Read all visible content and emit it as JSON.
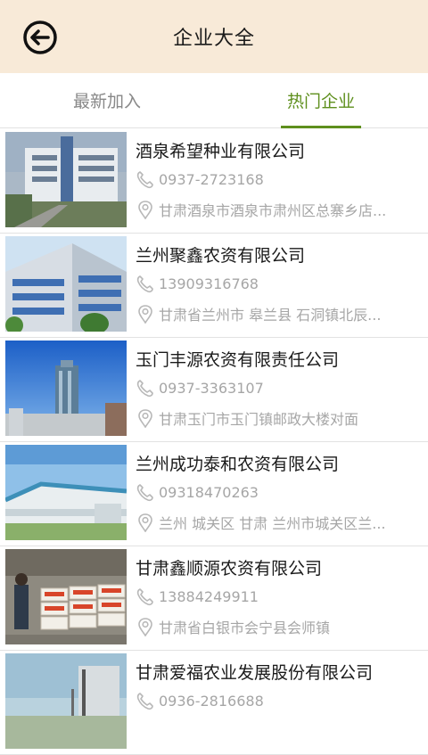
{
  "header": {
    "title": "企业大全",
    "back_icon": "back-arrow-icon"
  },
  "tabs": [
    {
      "label": "最新加入",
      "active": false
    },
    {
      "label": "热门企业",
      "active": true
    }
  ],
  "accent_color": "#5e8f1d",
  "header_color": "#f8ead8",
  "companies": [
    {
      "name": "酒泉希望种业有限公司",
      "phone": "0937-2723168",
      "address": "甘肃酒泉市酒泉市肃州区总寨乡店..."
    },
    {
      "name": "兰州聚鑫农资有限公司",
      "phone": "13909316768",
      "address": "甘肃省兰州市 皋兰县 石洞镇北辰..."
    },
    {
      "name": "玉门丰源农资有限责任公司",
      "phone": "0937-3363107",
      "address": "甘肃玉门市玉门镇邮政大楼对面"
    },
    {
      "name": "兰州成功泰和农资有限公司",
      "phone": "09318470263",
      "address": "兰州 城关区 甘肃 兰州市城关区兰..."
    },
    {
      "name": "甘肃鑫顺源农资有限公司",
      "phone": "13884249911",
      "address": "甘肃省白银市会宁县会师镇"
    },
    {
      "name": "甘肃爱福农业发展股份有限公司",
      "phone": "0936-2816688",
      "address": ""
    }
  ]
}
